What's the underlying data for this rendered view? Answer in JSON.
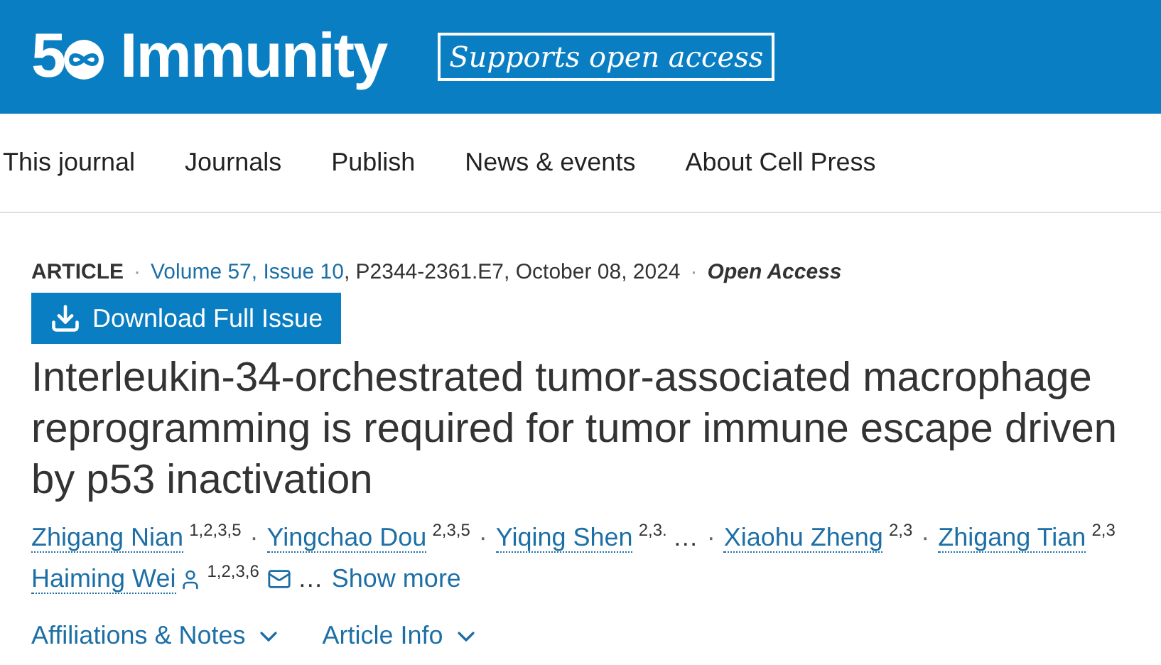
{
  "header": {
    "logo_number": "5",
    "journal": "Immunity",
    "badge": "Supports open access"
  },
  "nav": [
    "This journal",
    "Journals",
    "Publish",
    "News & events",
    "About Cell Press"
  ],
  "article": {
    "type": "ARTICLE",
    "separator": "·",
    "volume": "Volume 57, Issue 10",
    "citation": ", P2344-2361.E7, October 08, 2024",
    "access": "Open Access",
    "download": "Download Full Issue",
    "title_lines": [
      "Interleukin-34-orchestrated tumor-associated macrophage",
      "reprogramming is required for tumor immune escape driven",
      "by p53 inactivation"
    ],
    "author_lines": [
      [
        {
          "name": "Zhigang Nian",
          "sup": "1,2,3,5"
        },
        {
          "name": "Yingchao Dou",
          "sup": "2,3,5"
        },
        {
          "name": "Yiqing Shen",
          "sup": "2,3.",
          "after": "…"
        },
        {
          "name": "Xiaohu Zheng",
          "sup": "2,3"
        },
        {
          "name": "Zhigang Tian",
          "sup": "2,3"
        }
      ],
      [
        {
          "name": "Haiming Wei",
          "sup": "1,2,3,6",
          "corresponding": true,
          "email": true,
          "after": "…"
        }
      ]
    ],
    "show_more": "Show more",
    "sections": [
      "Affiliations & Notes",
      "Article Info"
    ]
  }
}
